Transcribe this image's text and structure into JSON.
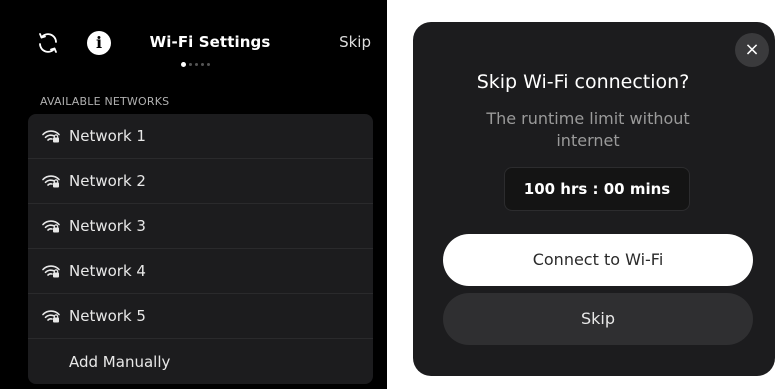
{
  "settings": {
    "title": "Wi-Fi Settings",
    "skip_label": "Skip",
    "info_glyph": "i",
    "section_label": "AVAILABLE NETWORKS",
    "page_indicator": {
      "current": 1,
      "total": 5
    }
  },
  "networks": [
    {
      "label": "Network 1",
      "icon": "wifi-lock-icon"
    },
    {
      "label": "Network 2",
      "icon": "wifi-lock-icon"
    },
    {
      "label": "Network 3",
      "icon": "wifi-lock-icon"
    },
    {
      "label": "Network 4",
      "icon": "wifi-lock-icon"
    },
    {
      "label": "Network 5",
      "icon": "wifi-lock-icon"
    }
  ],
  "add_manually_label": "Add Manually",
  "dialog": {
    "close_glyph": "×",
    "title": "Skip Wi-Fi connection?",
    "subtitle": "The runtime limit without internet",
    "limit_value": "100 hrs : 00 mins",
    "connect_label": "Connect to Wi-Fi",
    "skip_label": "Skip"
  },
  "colors": {
    "background": "#000000",
    "panel": "#1c1c1e",
    "primary_button": "#ffffff",
    "secondary_button": "#2f2f31"
  }
}
